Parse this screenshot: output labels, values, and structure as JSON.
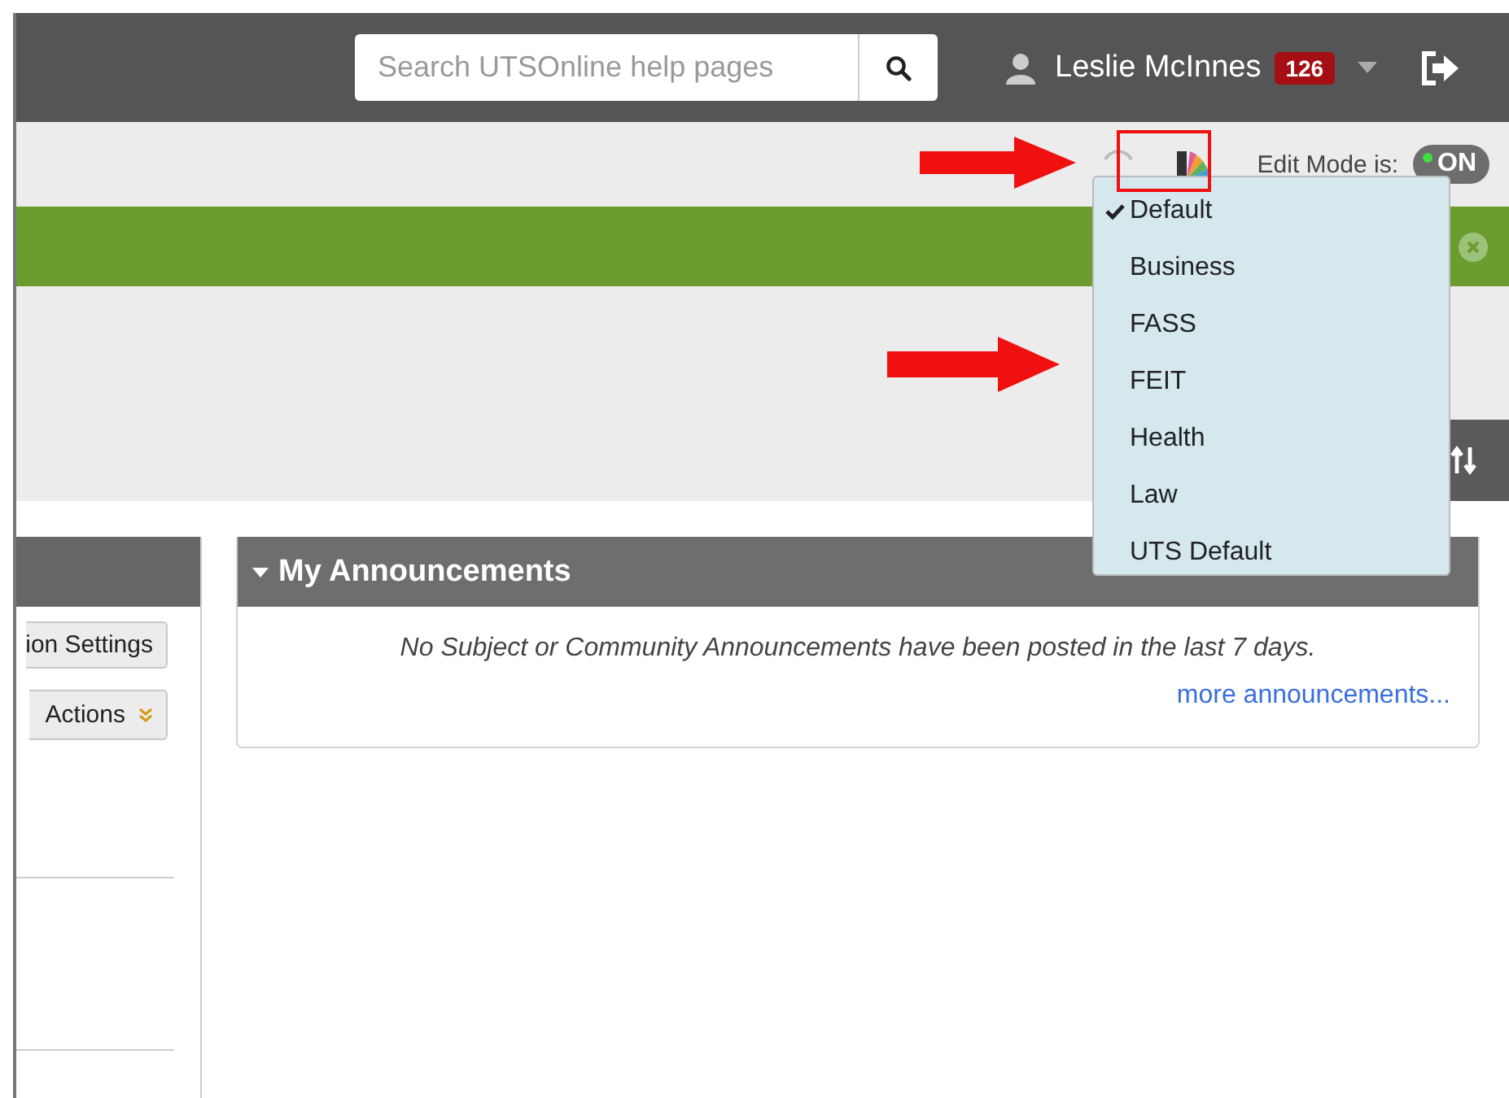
{
  "header": {
    "search": {
      "placeholder": "Search UTSOnline help pages"
    },
    "user": {
      "name": "Leslie McInnes",
      "badge": "126"
    }
  },
  "toolbar": {
    "edit_mode_label": "Edit Mode is:",
    "edit_mode": {
      "on": true,
      "label": "ON"
    }
  },
  "theme_menu": {
    "expanded": true,
    "items": [
      {
        "label": "Default",
        "selected": true
      },
      {
        "label": "Business",
        "selected": false
      },
      {
        "label": "FASS",
        "selected": false
      },
      {
        "label": "FEIT",
        "selected": false
      },
      {
        "label": "Health",
        "selected": false
      },
      {
        "label": "Law",
        "selected": false
      },
      {
        "label": "UTS Default",
        "selected": false
      }
    ]
  },
  "left_panel": {
    "buttons": [
      {
        "label": "ion Settings",
        "kind": "plain"
      },
      {
        "label": "Actions",
        "kind": "menu"
      }
    ]
  },
  "announcements": {
    "title": "My Announcements",
    "expanded": true,
    "message": "No Subject or Community Announcements have been posted in the last 7 days.",
    "link": "more announcements..."
  }
}
